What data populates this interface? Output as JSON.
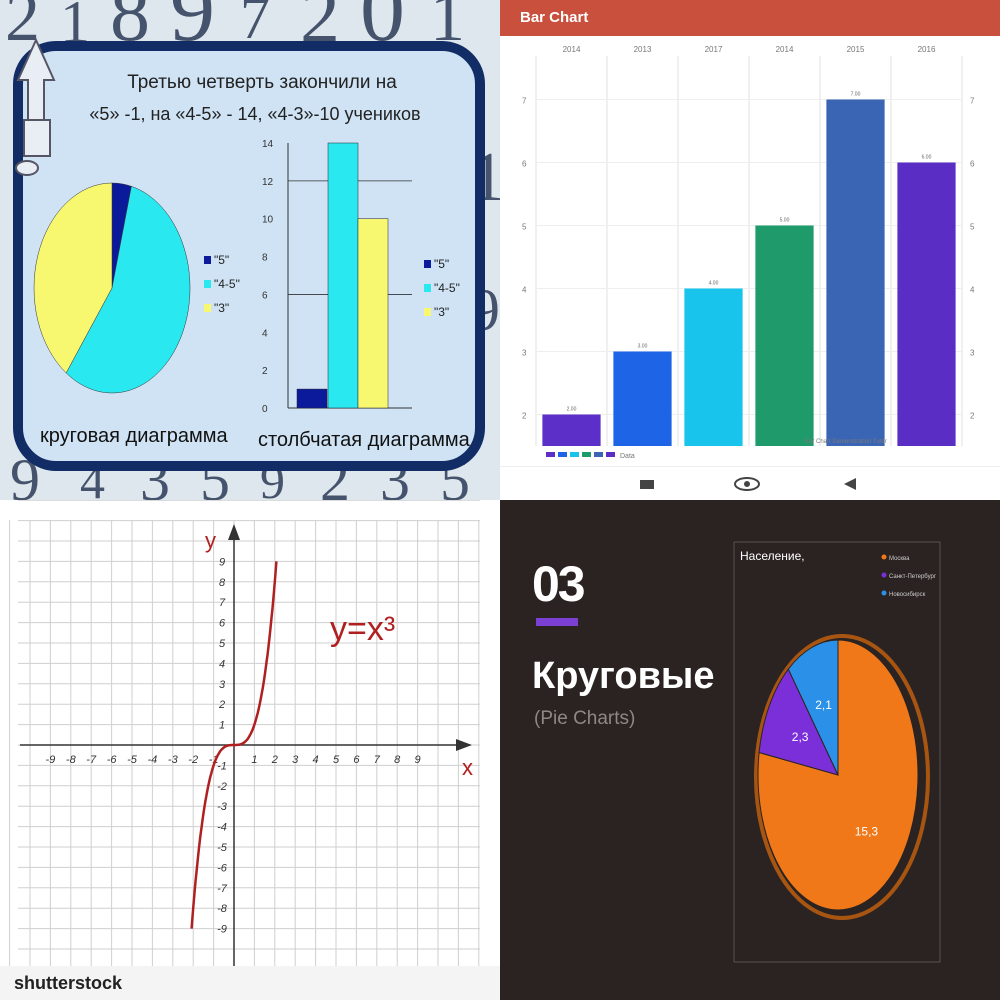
{
  "panels": {
    "top_left": {
      "title_line1": "Третью четверть закончили на",
      "title_line2": "«5» -1, на «4-5» - 14, «4-3»-10 учеников",
      "pie_caption": "круговая диаграмма",
      "bar_caption": "столбчатая диаграмма",
      "background_digits": "2 1 8 9 7 2 0 1 9 4 3 5 9 2 3 5 1 9"
    },
    "top_right": {
      "header_title": "Bar Chart"
    },
    "bottom_left": {
      "equation": "y=x³",
      "x_axis_label": "x",
      "y_axis_label": "y",
      "watermark": "shutterstock"
    },
    "bottom_right": {
      "section_number": "03",
      "title": "Круговые",
      "subtitle": "(Pie Charts)",
      "chart_title": "Население,"
    }
  },
  "colors": {
    "q1_blue": "#0a1a9a",
    "q1_cyan": "#2ae8f0",
    "q1_yellow": "#f8f870",
    "q2_header": "#c8503c",
    "q4_orange": "#f07818",
    "q4_purple": "#7b2fd8",
    "q4_blue": "#2a90e8",
    "curve": "#b02020"
  },
  "chart_data": [
    {
      "type": "pie",
      "labels": [
        "\"5\"",
        "\"4-5\"",
        "\"3\""
      ],
      "values": [
        1,
        14,
        10
      ],
      "colors": [
        "#0a1a9a",
        "#2ae8f0",
        "#f8f870"
      ],
      "legend": "right"
    },
    {
      "type": "bar",
      "categories": [
        "\"5\"",
        "\"4-5\"",
        "\"3\""
      ],
      "values": [
        1,
        14,
        10
      ],
      "colors": [
        "#0a1a9a",
        "#2ae8f0",
        "#f8f870"
      ],
      "yticks": [
        "0",
        "2",
        "4",
        "6",
        "8",
        "10",
        "12",
        "14"
      ],
      "ylim": [
        0,
        14
      ],
      "grid": true,
      "legend": "right"
    },
    {
      "type": "bar",
      "categories": [
        "2014",
        "2013",
        "2017",
        "2014",
        "2015",
        "2016"
      ],
      "values": [
        2.0,
        3.0,
        4.0,
        5.0,
        7.0,
        6.0
      ],
      "value_labels": [
        "2.00",
        "3.00",
        "4.00",
        "5.00",
        "7.00",
        "6.00"
      ],
      "colors": [
        "#5b2fc8",
        "#1e64e6",
        "#18c4ec",
        "#1f9a6a",
        "#3a64b4",
        "#5a2ec4"
      ],
      "yticks_left": [
        "2",
        "3",
        "4",
        "5",
        "6",
        "7"
      ],
      "yticks_right": [
        "2",
        "3",
        "4",
        "5",
        "6",
        "7"
      ],
      "ylim": [
        1.5,
        7.5
      ],
      "legend_label": "Data",
      "description": "Bar Chart Demonstration Tutor",
      "grid": true
    },
    {
      "type": "line",
      "title": "y=x³",
      "function": "x^3",
      "x": [
        -2.08,
        -2.0,
        -1.5,
        -1.0,
        -0.5,
        0.0,
        0.5,
        1.0,
        1.5,
        2.0,
        2.08
      ],
      "y": [
        -9.0,
        -8.0,
        -3.375,
        -1.0,
        -0.125,
        0.0,
        0.125,
        1.0,
        3.375,
        8.0,
        9.0
      ],
      "xlim": [
        -10,
        10
      ],
      "ylim": [
        -10,
        10
      ],
      "xticks": [
        "-9",
        "-8",
        "-7",
        "-6",
        "-5",
        "-4",
        "-3",
        "-2",
        "-1",
        "1",
        "2",
        "3",
        "4",
        "5",
        "6",
        "7",
        "8",
        "9"
      ],
      "yticks": [
        "9",
        "8",
        "7",
        "6",
        "5",
        "4",
        "3",
        "2",
        "1",
        "-1",
        "-2",
        "-3",
        "-4",
        "-5",
        "-6",
        "-7",
        "-8",
        "-9"
      ],
      "xlabel": "x",
      "ylabel": "y",
      "grid": true
    },
    {
      "type": "pie",
      "title": "Население,",
      "labels": [
        "Москва",
        "Санкт-Петербург",
        "Новосибирск"
      ],
      "values": [
        15.3,
        2.3,
        2.1
      ],
      "value_labels": [
        "15,3",
        "2,3",
        "2,1"
      ],
      "colors": [
        "#f07818",
        "#7b2fd8",
        "#2a90e8"
      ],
      "legend": "top-right"
    }
  ]
}
